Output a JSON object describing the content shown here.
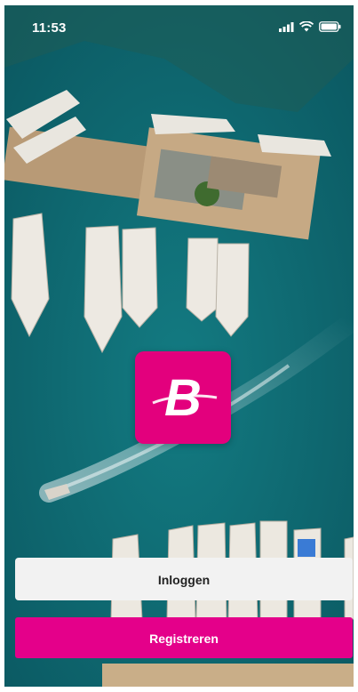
{
  "status_bar": {
    "time": "11:53",
    "icons": [
      "signal-icon",
      "wifi-icon",
      "battery-icon"
    ]
  },
  "logo": {
    "letter": "B",
    "color": "#e3007d"
  },
  "buttons": {
    "login_label": "Inloggen",
    "register_label": "Registreren"
  },
  "colors": {
    "accent": "#e4008a",
    "water": "#0f6b73",
    "login_bg": "#f2f2f2"
  },
  "background": {
    "description_icon": "marina-aerial-photo"
  }
}
